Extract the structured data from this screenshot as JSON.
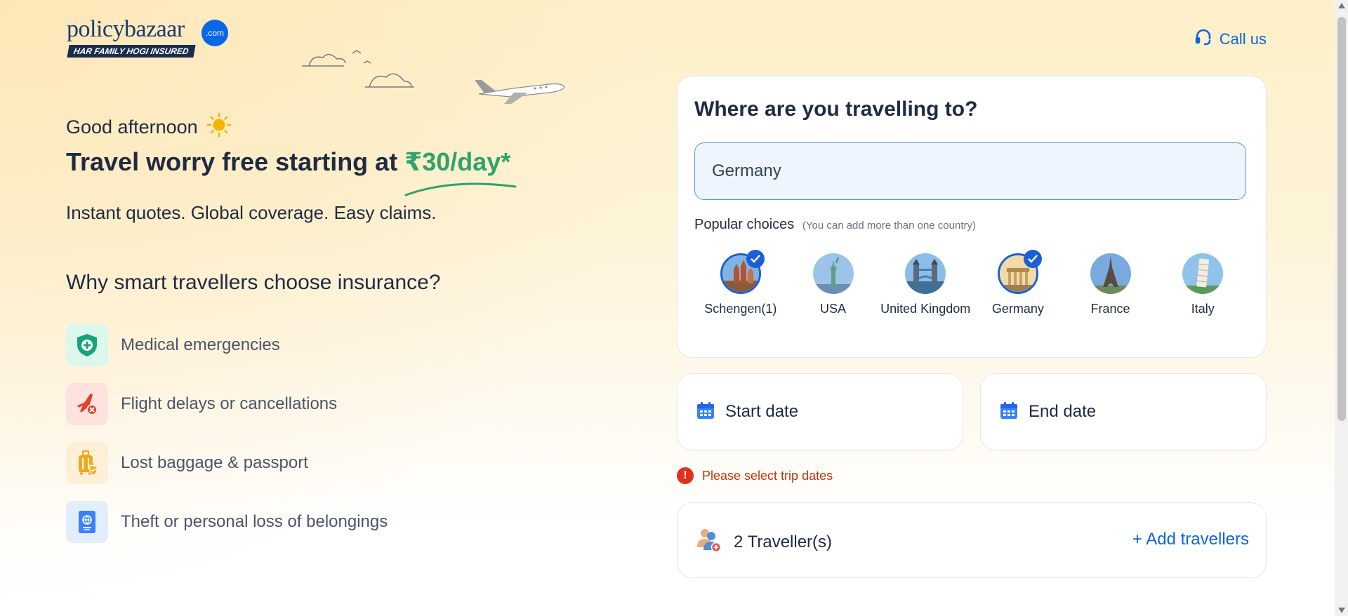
{
  "header": {
    "logo_text": "policybazaar",
    "logo_badge": ".com",
    "logo_tagline": "HAR FAMILY HOGI INSURED",
    "call_label": "Call us"
  },
  "hero": {
    "greeting": "Good afternoon",
    "headline_prefix": "Travel worry free starting at ",
    "headline_price": "₹30/day*",
    "subtext": "Instant quotes. Global coverage. Easy claims."
  },
  "why": {
    "title": "Why smart travellers choose insurance?",
    "items": [
      {
        "label": "Medical emergencies",
        "icon": "medical-shield-icon",
        "bg": "#dcf7ec",
        "color": "#16a37a"
      },
      {
        "label": "Flight delays or cancellations",
        "icon": "flight-cancel-icon",
        "bg": "#fde2de",
        "color": "#e0422b"
      },
      {
        "label": "Lost baggage & passport",
        "icon": "baggage-icon",
        "bg": "#fdf0d6",
        "color": "#f2a81a"
      },
      {
        "label": "Theft or personal loss of belongings",
        "icon": "passport-icon",
        "bg": "#e3eefc",
        "color": "#3b82f6"
      }
    ]
  },
  "destination": {
    "title": "Where are you travelling to?",
    "input_value": "Germany",
    "popular_label": "Popular choices",
    "popular_hint": "(You can add more than one country)",
    "choices": [
      {
        "label": "Schengen(1)",
        "selected": true
      },
      {
        "label": "USA",
        "selected": false
      },
      {
        "label": "United Kingdom",
        "selected": false
      },
      {
        "label": "Germany",
        "selected": true
      },
      {
        "label": "France",
        "selected": false
      },
      {
        "label": "Italy",
        "selected": false
      }
    ]
  },
  "dates": {
    "start_label": "Start date",
    "end_label": "End date",
    "error": "Please select trip dates"
  },
  "travellers": {
    "count_label": "2 Traveller(s)",
    "add_label": "+ Add travellers"
  },
  "colors": {
    "accent": "#0a66e8",
    "price": "#2fa36b",
    "error": "#c4320a"
  }
}
